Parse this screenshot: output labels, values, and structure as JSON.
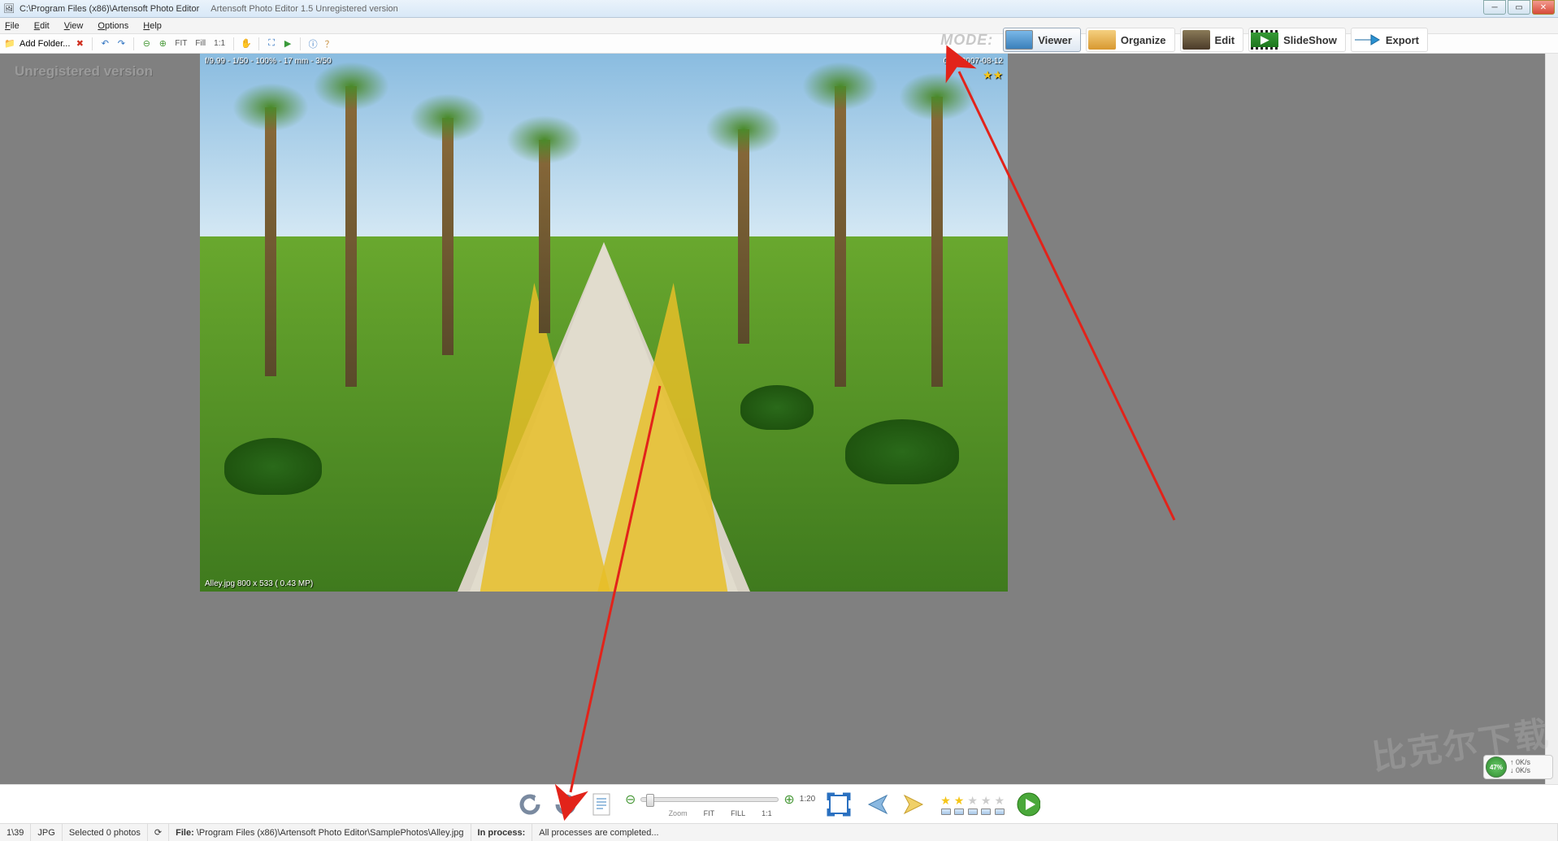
{
  "title": {
    "path": "C:\\Program Files (x86)\\Artensoft Photo Editor",
    "app": "Artensoft Photo Editor 1.5  Unregistered version"
  },
  "menu": {
    "file": "File",
    "edit": "Edit",
    "view": "View",
    "options": "Options",
    "help": "Help"
  },
  "toolbar": {
    "add_folder": "Add Folder...",
    "fit": "FIT",
    "fill": "Fill",
    "oneone": "1:1"
  },
  "mode": {
    "label": "MODE:",
    "viewer": "Viewer",
    "organize": "Organize",
    "edit": "Edit",
    "slideshow": "SlideShow",
    "export": "Export"
  },
  "viewer": {
    "watermark": "Unregistered version",
    "overlay_tl": "f/9.99 - 1/50 - 100% - 17 mm - 3/50",
    "overlay_tr": "0:00  2007-08-12",
    "overlay_bl": "Alley.jpg   800 x 533 ( 0.43 MP)",
    "stars": "★★"
  },
  "bottom": {
    "zoom_label": "Zoom",
    "fit": "FIT",
    "fill": "FILL",
    "oneone": "1:1",
    "ratio": "1:20"
  },
  "status": {
    "count": "1\\39",
    "fmt": "JPG",
    "selected": "Selected 0 photos",
    "file_label": "File:",
    "file_path": "\\Program Files (x86)\\Artensoft Photo Editor\\SamplePhotos\\Alley.jpg",
    "proc_label": "In process:",
    "proc_msg": "All processes are completed..."
  },
  "net": {
    "pct": "47%",
    "up": "0K/s",
    "dn": "0K/s"
  },
  "bk": "比克尔下载"
}
